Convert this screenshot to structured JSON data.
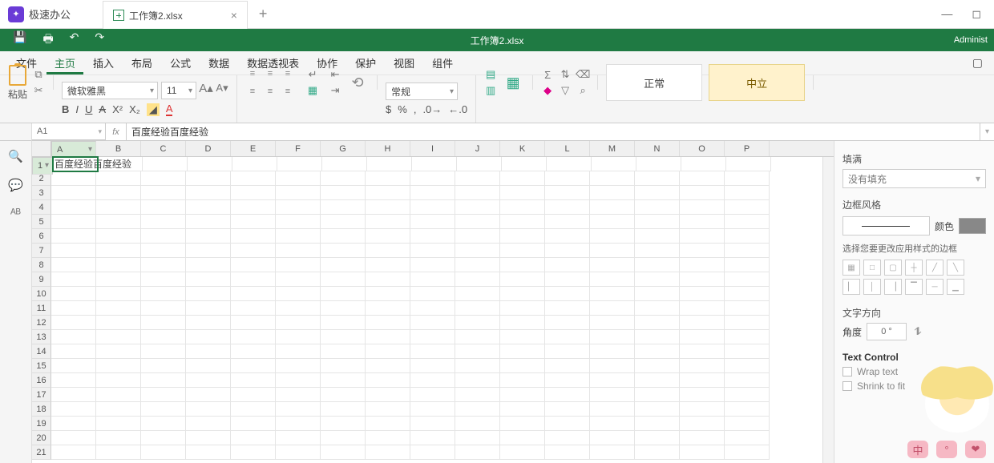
{
  "app": {
    "name": "极速办公"
  },
  "tab": {
    "title": "工作簿2.xlsx"
  },
  "quickbar": {
    "title": "工作簿2.xlsx",
    "user": "Administ"
  },
  "menu": {
    "items": [
      "文件",
      "主页",
      "插入",
      "布局",
      "公式",
      "数据",
      "数据透视表",
      "协作",
      "保护",
      "视图",
      "组件"
    ],
    "activeIndex": 1
  },
  "ribbon": {
    "pasteLabel": "粘贴",
    "fontName": "微软雅黑",
    "fontSize": "11",
    "numberFormat": "常规",
    "styleNormal": "正常",
    "styleNeutral": "中立"
  },
  "namebox": "A1",
  "formula": "百度经验百度经验",
  "columns": [
    "A",
    "B",
    "C",
    "D",
    "E",
    "F",
    "G",
    "H",
    "I",
    "J",
    "K",
    "L",
    "M",
    "N",
    "O",
    "P"
  ],
  "rowCount": 21,
  "cellA1": "百度经验百度经验",
  "sidebar": {
    "fillLabel": "填满",
    "fillValue": "没有填充",
    "borderStyleLabel": "边框风格",
    "colorLabel": "颜色",
    "chooseHint": "选择您要更改应用样式的边框",
    "textDirLabel": "文字方向",
    "angleLabel": "角度",
    "angleValue": "0 °",
    "textControlLabel": "Text Control",
    "wrapLabel": "Wrap text",
    "shrinkLabel": "Shrink to fit"
  }
}
